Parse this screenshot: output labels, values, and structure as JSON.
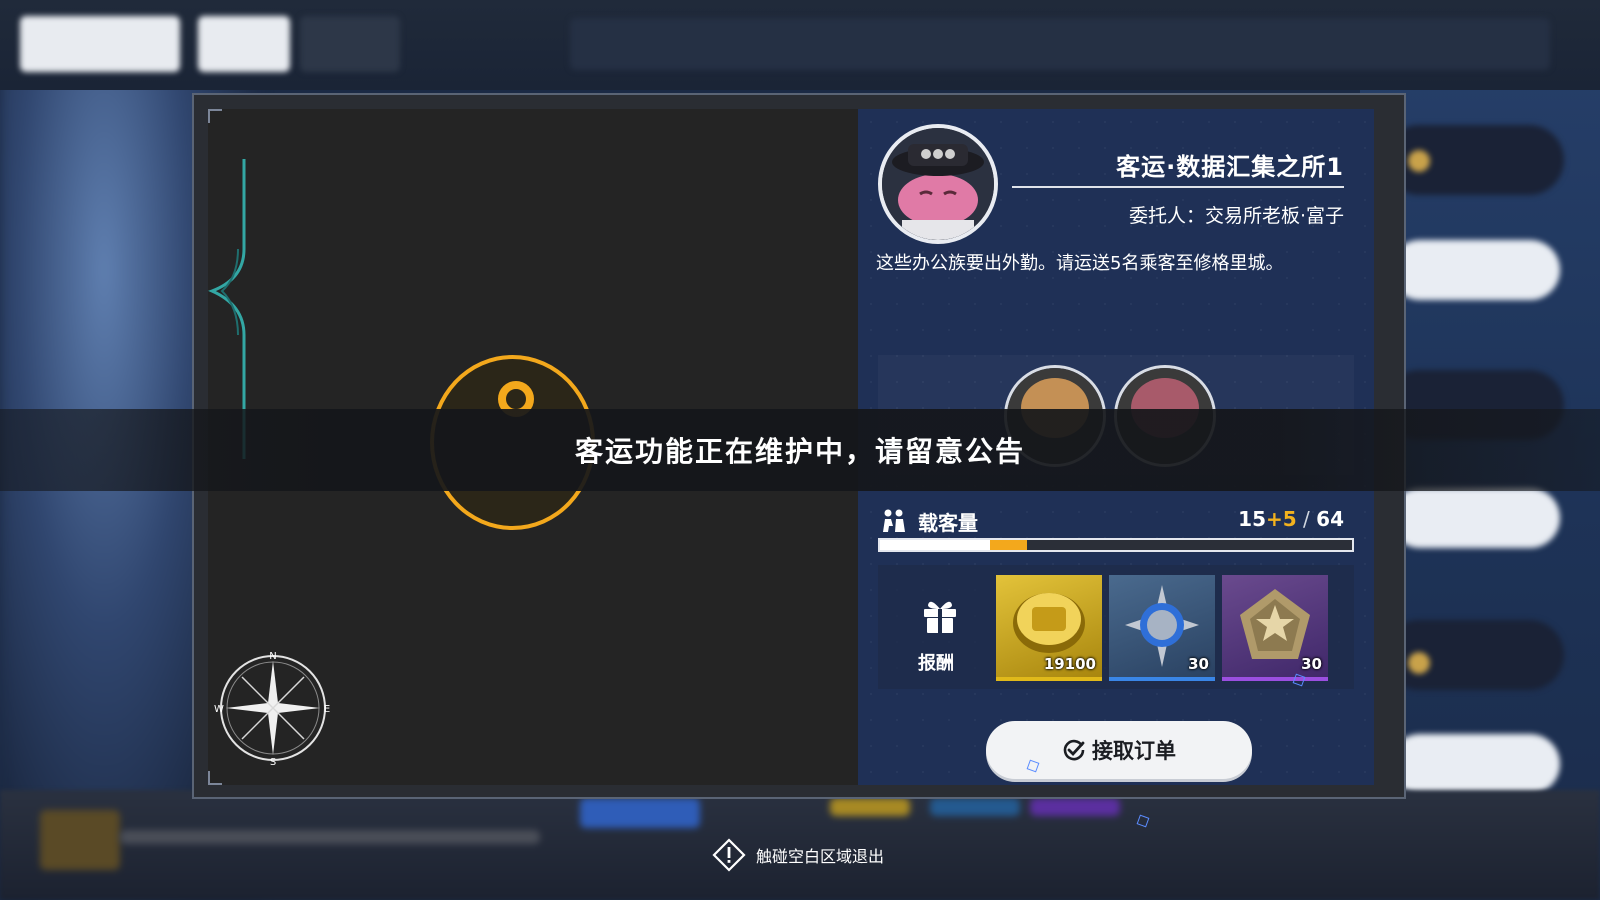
{
  "order": {
    "title": "客运·数据汇集之所1",
    "client": "委托人：交易所老板·富子",
    "description": "这些办公族要出外勤。请运送5名乘客至修格里城。"
  },
  "capacity": {
    "label": "载客量",
    "base": "15",
    "extra": "+5",
    "separator": " / ",
    "max": "64",
    "fill_base_fraction": 0.234,
    "fill_extra_fraction": 0.078
  },
  "rewards": {
    "label": "报酬",
    "items": [
      {
        "icon": "gold-coin-icon",
        "count": "19100",
        "rarity_color": "#d9b21a"
      },
      {
        "icon": "blue-badge-icon",
        "count": "30",
        "rarity_color": "#3a86e6"
      },
      {
        "icon": "purple-medal-icon",
        "count": "30",
        "rarity_color": "#9b4fe0"
      }
    ]
  },
  "accept_button": {
    "label": "接取订单",
    "icon": "check-circle-icon"
  },
  "banner": {
    "text": "客运功能正在维护中，请留意公告"
  },
  "exit_hint": {
    "text": "触碰空白区域退出",
    "icon": "warning-diamond-icon"
  },
  "compass": {
    "n": "N",
    "s": "S",
    "e": "E",
    "w": "W"
  },
  "colors": {
    "accent_gold": "#f3a81c",
    "panel_blue": "#1f3056",
    "map_dark": "#242424"
  }
}
